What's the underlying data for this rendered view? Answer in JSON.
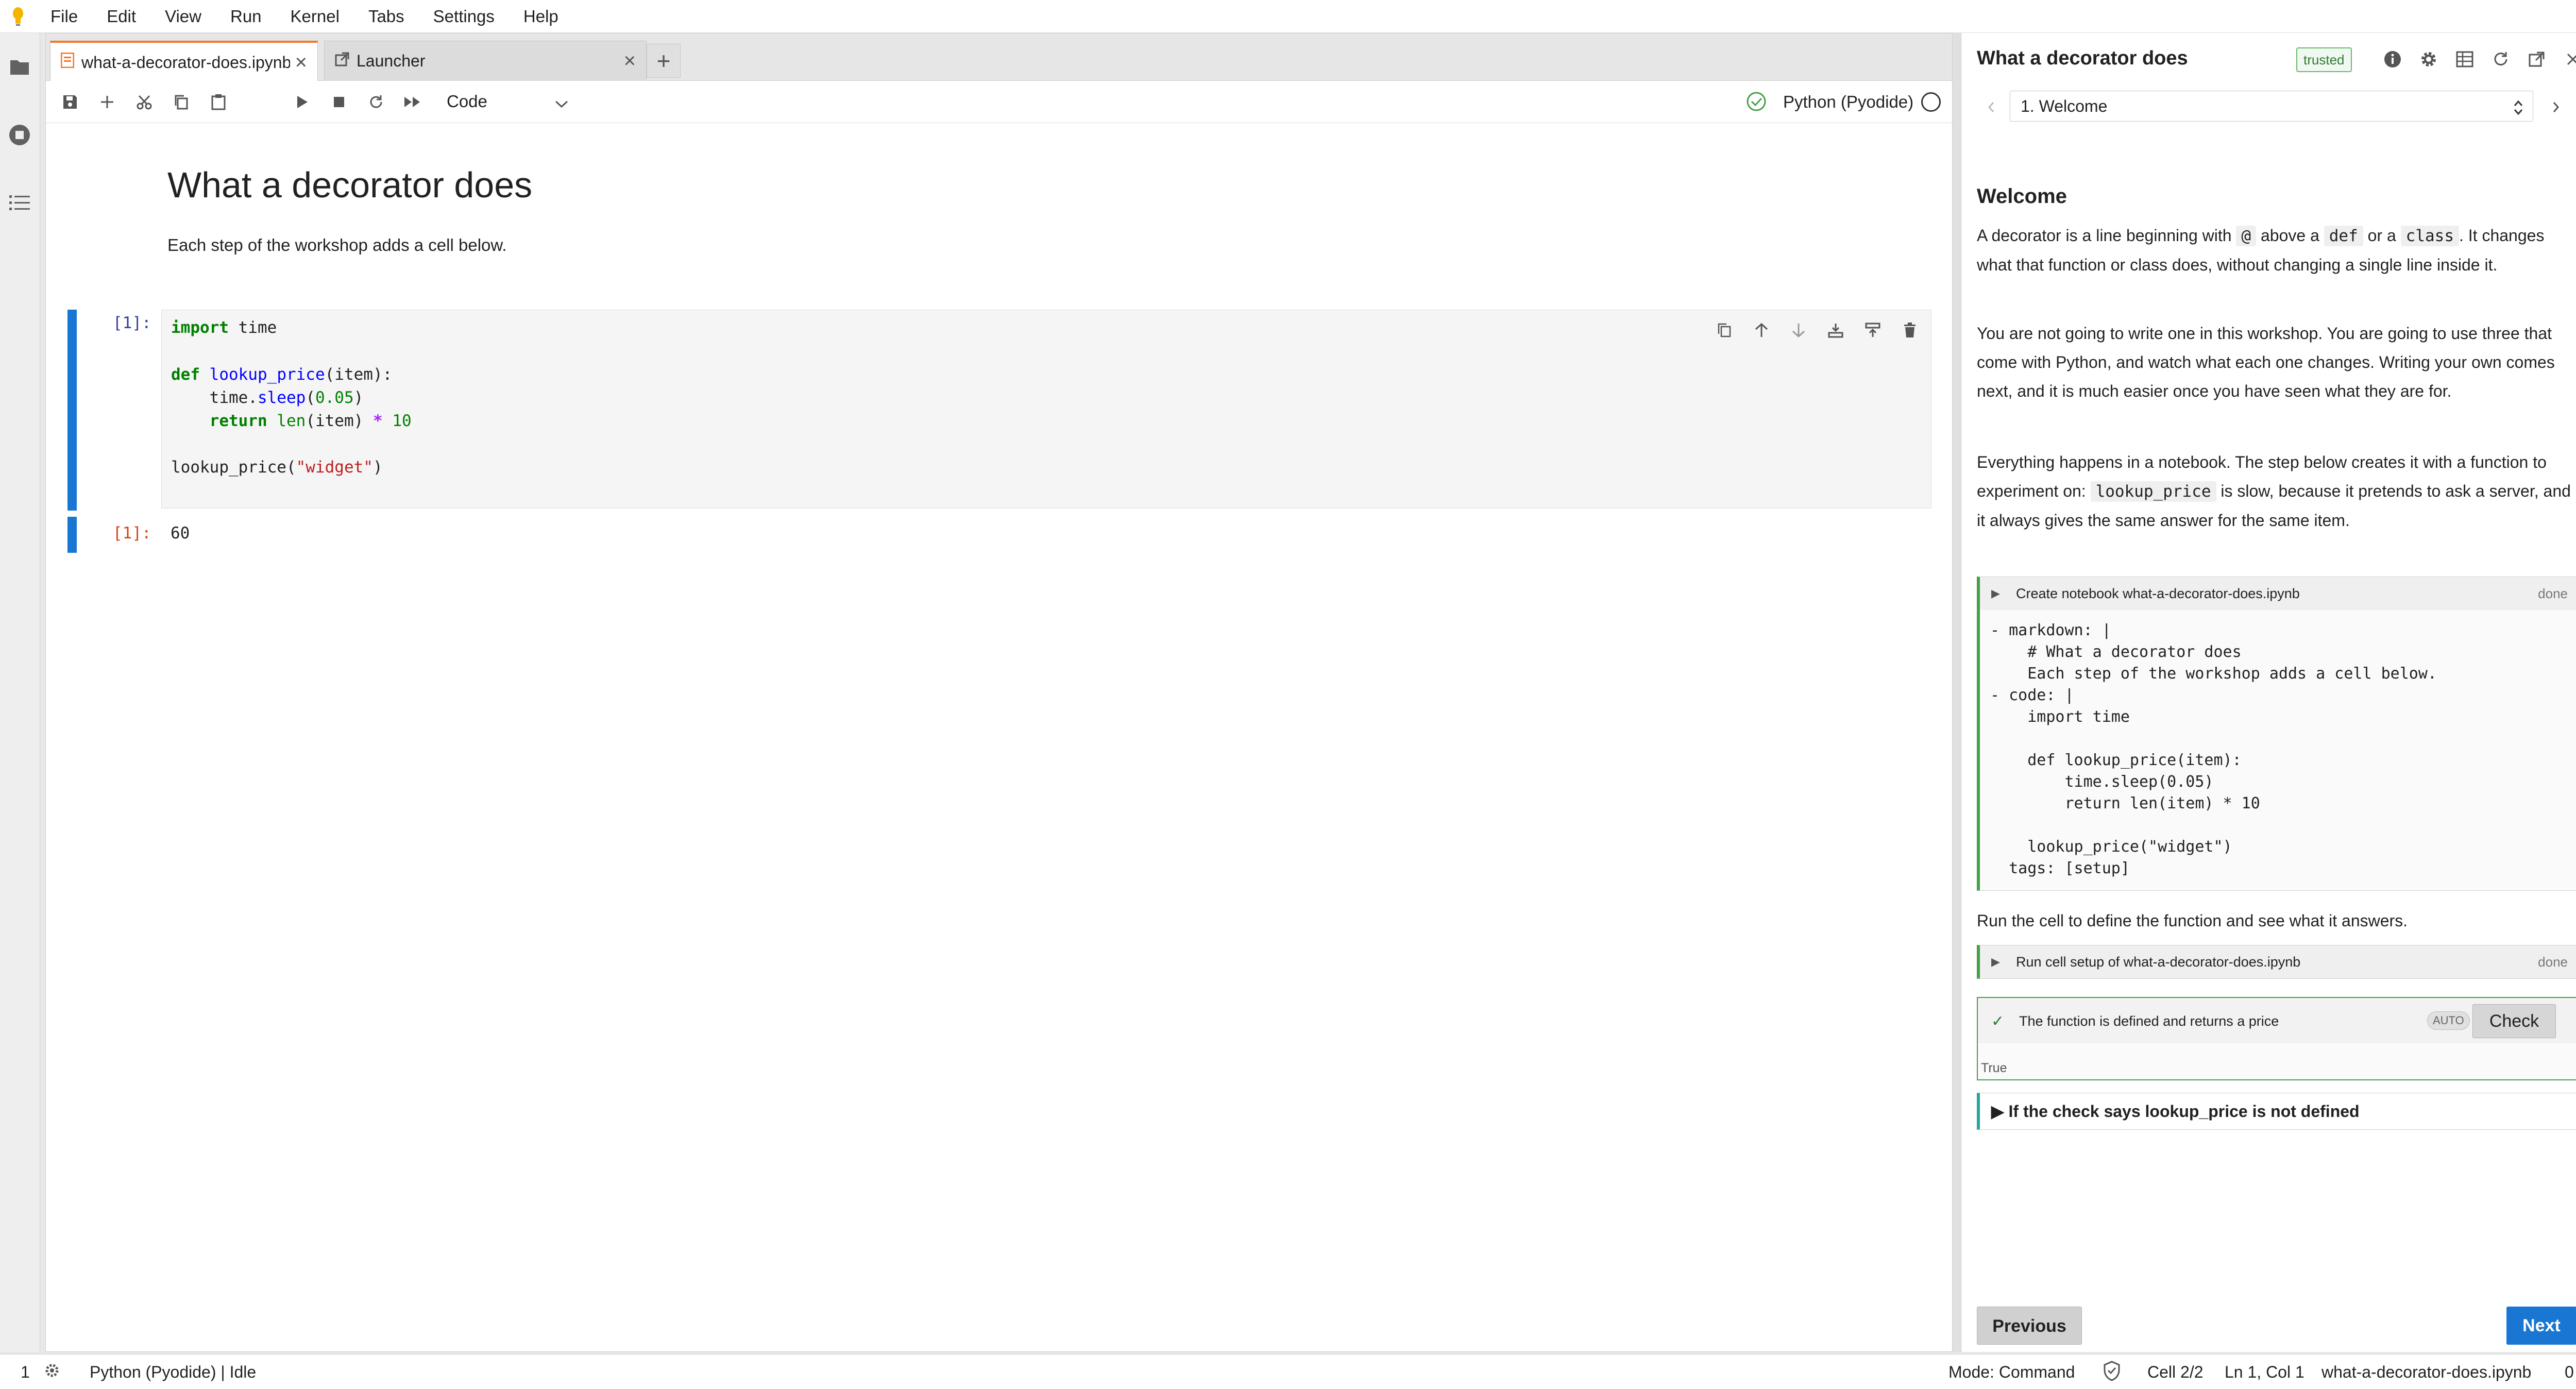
{
  "menubar": {
    "items": [
      "File",
      "Edit",
      "View",
      "Run",
      "Kernel",
      "Tabs",
      "Settings",
      "Help"
    ]
  },
  "tabs": [
    {
      "label": "what-a-decorator-does.ipynb",
      "icon": "notebook-icon"
    },
    {
      "label": "Launcher",
      "icon": "launcher-icon"
    }
  ],
  "toolbar": {
    "cell_type": "Code",
    "kernel_name": "Python (Pyodide)"
  },
  "notebook": {
    "title": "What a decorator does",
    "subtitle": "Each step of the workshop adds a cell below.",
    "input_prompt": "[1]:",
    "output_prompt": "[1]:",
    "output_value": "60",
    "code_lines": [
      "import time",
      "",
      "def lookup_price(item):",
      "    time.sleep(0.05)",
      "    return len(item) * 10",
      "",
      "lookup_price(\"widget\")"
    ]
  },
  "guide": {
    "title": "What a decorator does",
    "trusted_badge": "trusted",
    "step_select": "1. Welcome",
    "heading": "Welcome",
    "p1_a": "A decorator is a line beginning with",
    "p1_code1": "@",
    "p1_b": "above a",
    "p1_code2": "def",
    "p1_c": "or a",
    "p1_code3": "class",
    "p1_d": ". It changes what that function or class does, without changing a single line inside it.",
    "p2": "You are not going to write one in this workshop. You are going to use three that come with Python, and watch what each one changes. Writing your own comes next, and it is much easier once you have seen what they are for.",
    "p3_a": "Everything happens in a notebook. The step below creates it with a function to experiment on:",
    "p3_code": "lookup_price",
    "p3_b": "is slow, because it pretends to ask a server, and it always gives the same answer for the same item.",
    "step1": {
      "label": "Create notebook what-a-decorator-does.ipynb",
      "status": "done",
      "yaml": [
        "- markdown: |",
        "    # What a decorator does",
        "    Each step of the workshop adds a cell below.",
        "- code: |",
        "    import time",
        "",
        "    def lookup_price(item):",
        "        time.sleep(0.05)",
        "        return len(item) * 10",
        "",
        "    lookup_price(\"widget\")",
        "  tags: [setup]"
      ]
    },
    "p4": "Run the cell to define the function and see what it answers.",
    "step2": {
      "label": "Run cell setup of what-a-decorator-does.ipynb",
      "status": "done"
    },
    "check": {
      "label": "The function is defined and returns a price",
      "badge": "AUTO",
      "button": "Check",
      "result": "True"
    },
    "hint": "If the check says lookup_price is not defined",
    "prev_button": "Previous",
    "next_button": "Next"
  },
  "statusbar": {
    "count": "1",
    "kernel_status": "Python (Pyodide) | Idle",
    "mode": "Mode: Command",
    "cell": "Cell 2/2",
    "position": "Ln 1, Col 1",
    "filename": "what-a-decorator-does.ipynb",
    "notifications": "0"
  },
  "colors": {
    "accent": "#1976d2",
    "tab_active": "#f37726",
    "success": "#43a047"
  }
}
